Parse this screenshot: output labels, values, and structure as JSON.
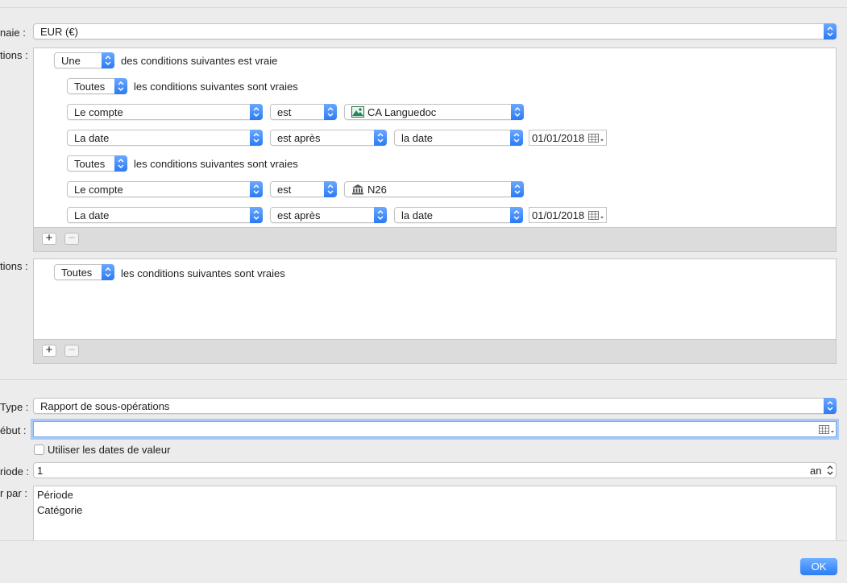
{
  "currency": {
    "label": "naie :",
    "value": "EUR (€)"
  },
  "conditions": {
    "label": "tions :",
    "root_quantifier": "Une",
    "root_text": "des conditions suivantes est vraie",
    "groups": [
      {
        "quantifier": "Toutes",
        "text": "les conditions suivantes sont vraies",
        "rules": [
          {
            "field": "Le compte",
            "operator": "est",
            "value": "CA Languedoc",
            "value_icon": "bank-logo-icon"
          },
          {
            "field": "La date",
            "operator": "est après",
            "value": "la date",
            "date": "01/01/2018"
          }
        ]
      },
      {
        "quantifier": "Toutes",
        "text": "les conditions suivantes sont vraies",
        "rules": [
          {
            "field": "Le compte",
            "operator": "est",
            "value": "N26",
            "value_icon": "bank-building-icon"
          },
          {
            "field": "La date",
            "operator": "est après",
            "value": "la date",
            "date": "01/01/2018"
          }
        ]
      }
    ],
    "add_label": "+",
    "remove_label": "−"
  },
  "filters": {
    "label": "tions :",
    "quantifier": "Toutes",
    "text": "les conditions suivantes sont vraies",
    "add_label": "+",
    "remove_label": "−"
  },
  "report": {
    "type_label": "Type :",
    "type_value": "Rapport de sous-opérations",
    "start_label": "ébut :",
    "start_value": "",
    "value_dates_label": "Utiliser les dates de valeur",
    "period_label": "riode :",
    "period_value": "1",
    "period_unit": "an",
    "group_label": "r par :",
    "group_items": [
      "Période",
      "Catégorie"
    ]
  },
  "ok_label": "OK"
}
